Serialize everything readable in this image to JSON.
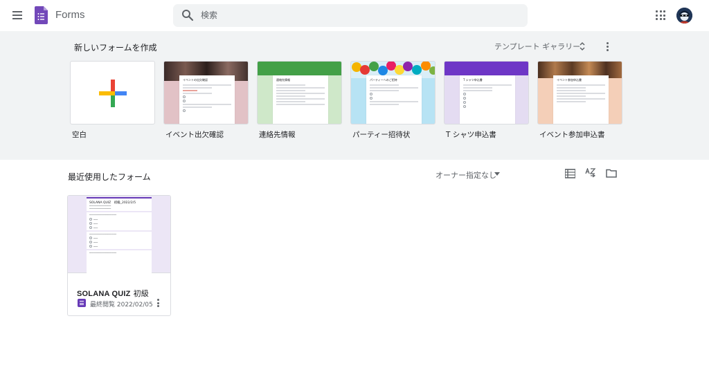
{
  "header": {
    "app_name": "Forms",
    "search_placeholder": "検索",
    "icons": [
      "main-menu-icon",
      "forms-logo-icon",
      "search-icon",
      "apps-grid-icon",
      "account-avatar"
    ]
  },
  "templates": {
    "heading": "新しいフォームを作成",
    "gallery_label": "テンプレート ギャラリー",
    "items": [
      {
        "label": "空白",
        "accent": "#ffffff"
      },
      {
        "label": "イベント出欠確認",
        "accent": "#e2c2c6",
        "form_title": "イベントの出欠確認"
      },
      {
        "label": "連絡先情報",
        "accent": "#43a047",
        "form_title": "連絡先情報"
      },
      {
        "label": "パーティー招待状",
        "accent": "#b7e3f4",
        "form_title": "パーティーへのご招待"
      },
      {
        "label": "T シャツ申込書",
        "accent": "#6e36c6",
        "form_title": "T シャツ申込書"
      },
      {
        "label": "イベント参加申込書",
        "accent": "#f4cfb8",
        "form_title": "イベント参加申込書"
      }
    ]
  },
  "recent": {
    "heading": "最近使用したフォーム",
    "owner_filter": "オーナー指定なし",
    "forms": [
      {
        "title_en": "SOLANA QUIZ",
        "title_jp": "初級",
        "meta": "最終閲覧 2022/02/05",
        "thumb_title": "SOLANA QUIZ　初級_2022/2/5"
      }
    ]
  },
  "colors": {
    "brand_purple": "#673ab7",
    "template_bg": "#f1f3f4",
    "search_bg": "#f1f3f4"
  }
}
